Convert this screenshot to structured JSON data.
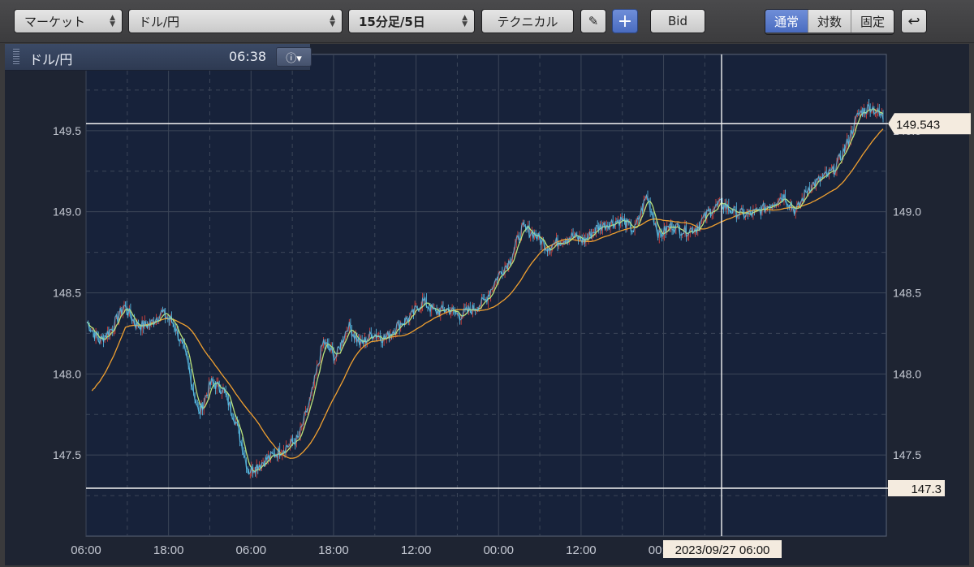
{
  "toolbar": {
    "market_label": "マーケット",
    "symbol_label": "ドル/円",
    "period_label": "15分足/5日",
    "technical_label": "テクニカル",
    "bid_label": "Bid",
    "scale_normal": "通常",
    "scale_log": "対数",
    "scale_fixed": "固定"
  },
  "infobar": {
    "symbol": "ドル/円",
    "time": "06:38"
  },
  "chart_data": {
    "type": "line",
    "title": "",
    "xlabel": "",
    "ylabel": "",
    "ylim": [
      147.0,
      149.97
    ],
    "grid": true,
    "log_scale": false,
    "x_tick_labels": [
      "06:00",
      "18:00",
      "06:00",
      "18:00",
      "12:00",
      "00:00",
      "12:00",
      "00:00"
    ],
    "y_ticks": [
      147.5,
      148.0,
      148.5,
      149.0,
      149.5
    ],
    "y_tick_labels": [
      "147.5",
      "148.0",
      "148.5",
      "149.0",
      "149.5"
    ],
    "current_price": 149.543,
    "current_price_label": "149.543",
    "crosshair_price_label": "147.3",
    "crosshair_time_label": "2023/09/27 06:00",
    "series": [
      {
        "values": [
          148.32,
          148.2,
          148.28,
          148.42,
          148.3,
          148.3,
          148.38,
          148.31,
          148.1,
          147.75,
          147.95,
          147.9,
          147.7,
          147.4,
          147.45,
          147.5,
          147.55,
          147.6,
          147.85,
          148.2,
          148.1,
          148.3,
          148.18,
          148.25,
          148.22,
          148.3,
          148.35,
          148.45,
          148.38,
          148.4,
          148.36,
          148.4,
          148.45,
          148.6,
          148.7,
          148.9,
          148.86,
          148.78,
          148.82,
          148.85,
          148.82,
          148.9,
          148.93,
          148.95,
          148.88,
          149.1,
          148.85,
          148.92,
          148.88,
          148.9,
          149.0,
          149.05,
          149.0,
          148.98,
          149.0,
          149.05,
          149.1,
          149.0,
          149.15,
          149.2,
          149.25,
          149.4,
          149.6,
          149.65,
          149.58
        ]
      }
    ],
    "colors": {
      "price": "#5bc4ee",
      "up": "#e8453c",
      "short_ma": "#b9e07a",
      "long_ma": "#f0a030",
      "grid": "#3c4658",
      "axis_text": "#c4c8d2"
    }
  }
}
